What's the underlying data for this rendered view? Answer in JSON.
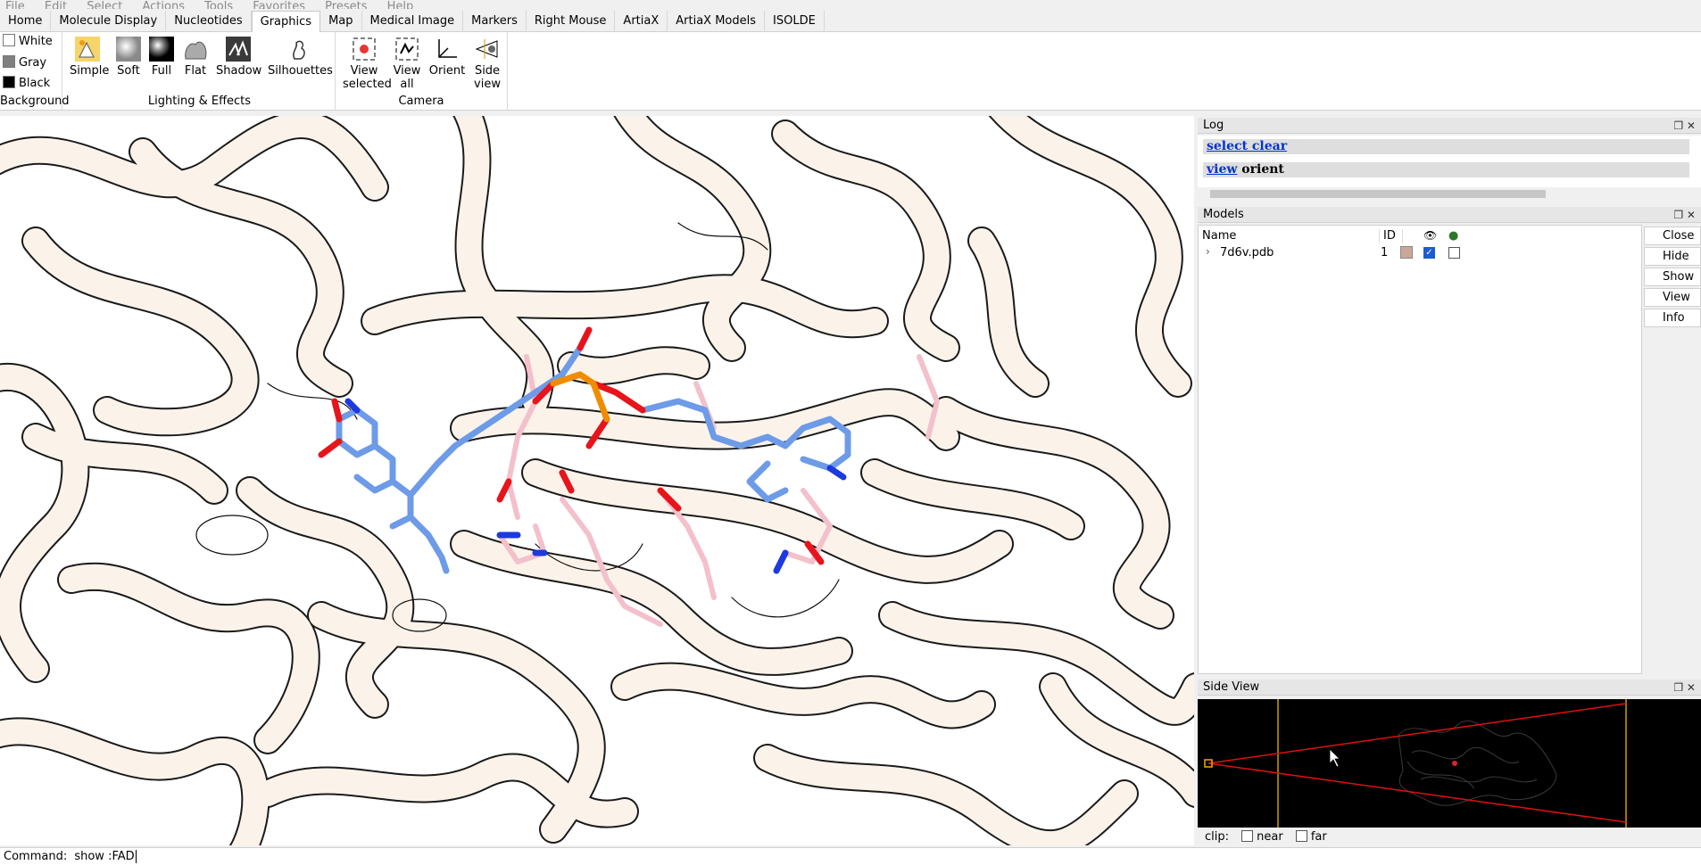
{
  "menu": [
    "File",
    "Edit",
    "Select",
    "Actions",
    "Tools",
    "Favorites",
    "Presets",
    "Help"
  ],
  "tabs": [
    {
      "label": "Home",
      "active": false
    },
    {
      "label": "Molecule Display",
      "active": false
    },
    {
      "label": "Nucleotides",
      "active": false
    },
    {
      "label": "Graphics",
      "active": true
    },
    {
      "label": "Map",
      "active": false
    },
    {
      "label": "Medical Image",
      "active": false
    },
    {
      "label": "Markers",
      "active": false
    },
    {
      "label": "Right Mouse",
      "active": false
    },
    {
      "label": "ArtiaX",
      "active": false
    },
    {
      "label": "ArtiaX Models",
      "active": false
    },
    {
      "label": "ISOLDE",
      "active": false
    }
  ],
  "ribbon": {
    "background": {
      "label": "Background",
      "options": [
        {
          "label": "White",
          "color": "#ffffff"
        },
        {
          "label": "Gray",
          "color": "#808080"
        },
        {
          "label": "Black",
          "color": "#000000"
        }
      ]
    },
    "lighting": {
      "label": "Lighting & Effects",
      "buttons": [
        "Simple",
        "Soft",
        "Full",
        "Flat",
        "Shadow",
        "Silhouettes"
      ]
    },
    "camera": {
      "label": "Camera",
      "buttons": [
        {
          "line1": "View",
          "line2": "selected"
        },
        {
          "line1": "View",
          "line2": "all"
        },
        {
          "line1": "Orient",
          "line2": ""
        },
        {
          "line1": "Side",
          "line2": "view"
        }
      ]
    }
  },
  "log": {
    "title": "Log",
    "lines": [
      {
        "link": "select clear",
        "rest": ""
      },
      {
        "link": "view",
        "rest": " orient"
      }
    ]
  },
  "models": {
    "title": "Models",
    "columns": {
      "name": "Name",
      "id": "ID"
    },
    "rows": [
      {
        "name": "7d6v.pdb",
        "id": "1",
        "color": "#c9a898",
        "shown": true,
        "selected": false
      }
    ],
    "buttons": [
      "Close",
      "Hide",
      "Show",
      "View",
      "Info"
    ]
  },
  "side_view": {
    "title": "Side View",
    "clip_label": "clip:",
    "near_label": "near",
    "far_label": "far"
  },
  "command": {
    "label": "Command:",
    "value": "show :FAD"
  },
  "colors": {
    "ribbon_tube": "#fbf3ea",
    "ligand_carbon": "#6d9be8",
    "residue_carbon": "#f3c0cc",
    "oxygen": "#e8141c",
    "phosphorus": "#f08c00",
    "nitrogen": "#1d39e0",
    "link": "#0033cc"
  }
}
